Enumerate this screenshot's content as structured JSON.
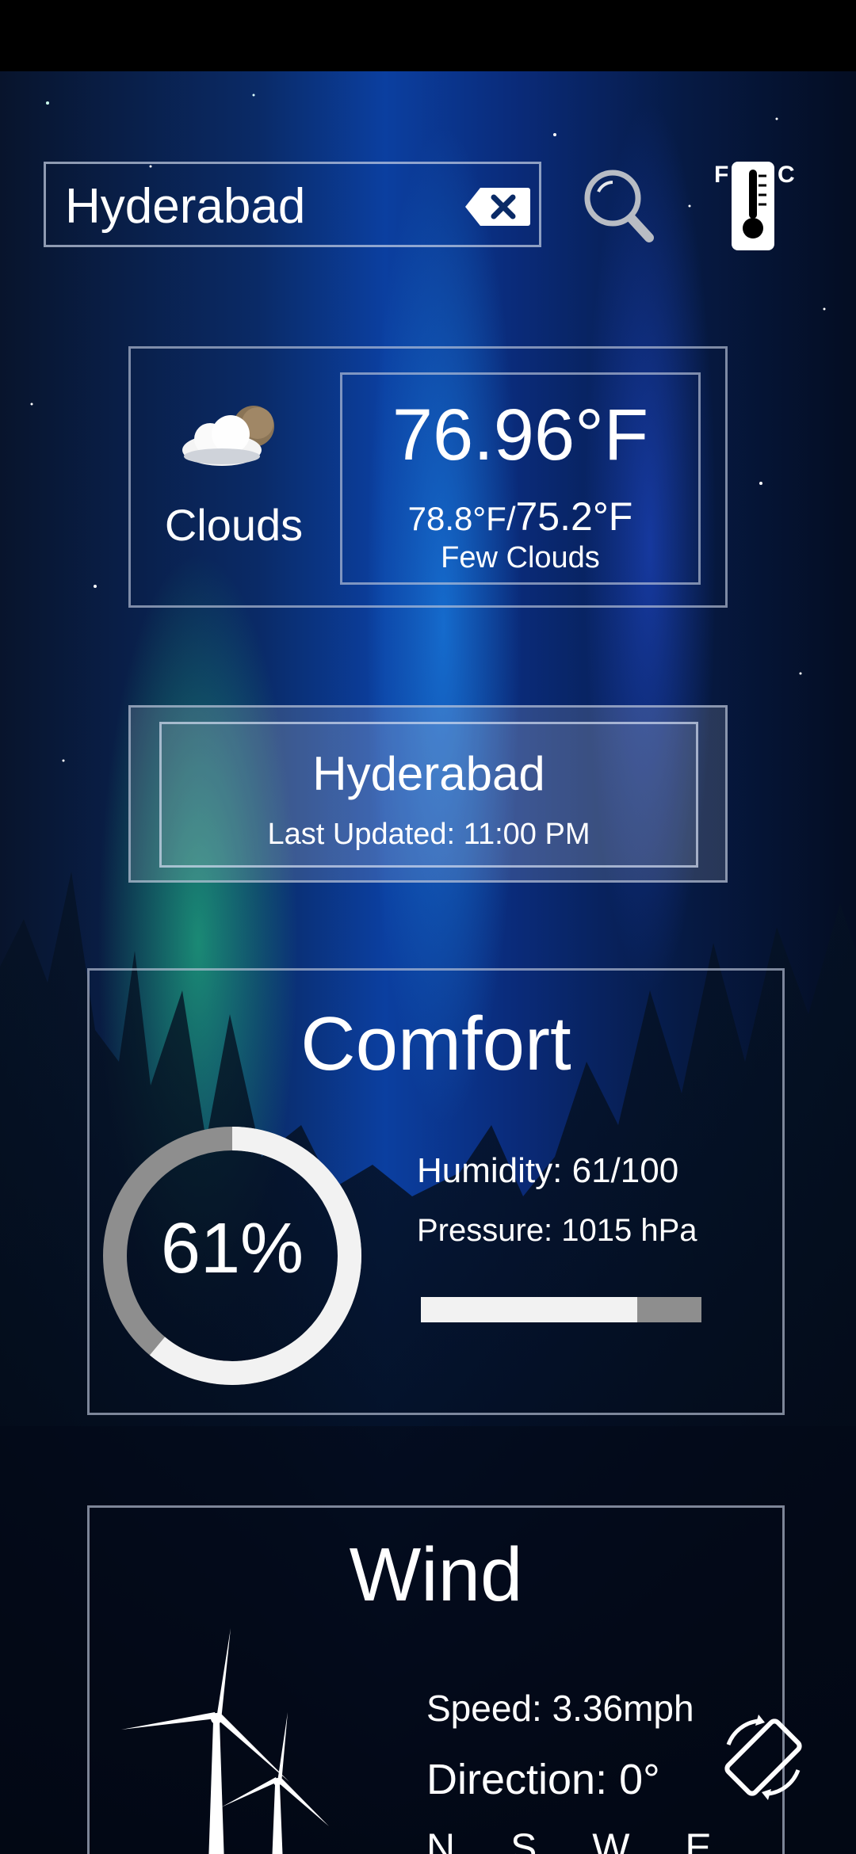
{
  "search": {
    "value": "Hyderabad",
    "placeholder": ""
  },
  "icons": {
    "clear": "backspace-clear-icon",
    "search": "search-magnifier-icon",
    "unit_toggle": "thermometer-fahrenheit-celsius-icon",
    "weather": "cloud-sun-icon",
    "gauge": "humidity-ring-gauge",
    "wind": "wind-turbine-icon",
    "rotate": "screen-rotate-icon"
  },
  "unit_toggle": {
    "f_label": "F",
    "c_label": "C"
  },
  "weather": {
    "condition": "Clouds",
    "temperature": "76.96°F",
    "temp_high": "78.8°F",
    "temp_separator": "/",
    "temp_low": "75.2°F",
    "description": "Few Clouds"
  },
  "location": {
    "city": "Hyderabad",
    "last_updated": "Last Updated: 11:00 PM"
  },
  "comfort": {
    "title": "Comfort",
    "humidity_percent_label": "61%",
    "humidity_value": 61,
    "humidity_text": "Humidity: 61/100",
    "pressure_text": "Pressure: 1015 hPa",
    "pressure_bar_fill": 0.77
  },
  "wind": {
    "title": "Wind",
    "speed_text": "Speed: 3.36mph",
    "direction_text": "Direction: 0°",
    "compass_text": "N S W E"
  },
  "colors": {
    "background_top": "#0a2a66",
    "panel_border": "#c0c8dc",
    "gauge_track": "#8e8e8e",
    "gauge_fill": "#f2f2f2",
    "text": "#ffffff"
  }
}
